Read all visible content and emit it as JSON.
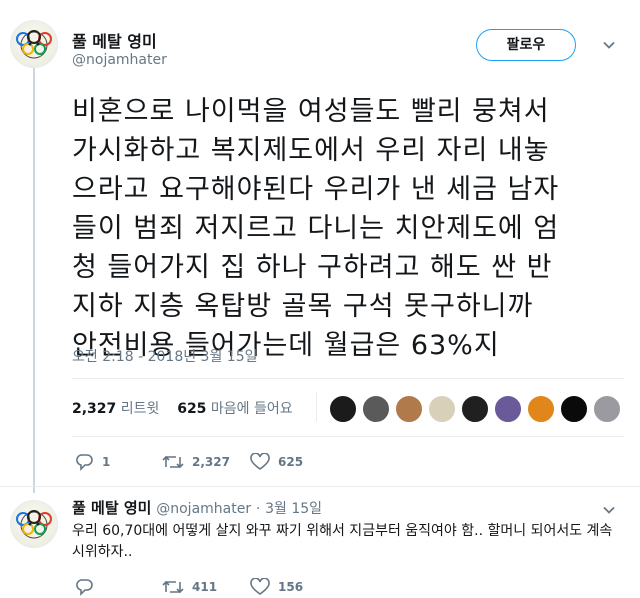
{
  "main_tweet": {
    "display_name": "풀 메탈 영미",
    "handle": "@nojamhater",
    "follow_label": "팔로우",
    "text_lines": [
      "비혼으로 나이먹을 여성들도 빨리 뭉쳐서",
      "가시화하고 복지제도에서 우리 자리 내놓",
      "으라고 요구해야된다 우리가 낸 세금 남자",
      "들이 범죄 저지르고 다니는 치안제도에 엄",
      "청 들어가지 집 하나 구하려고 해도 싼 반",
      "지하 지층 옥탑방 골목 구석 못구하니까",
      "안전비용 들어가는데 월급은 63%지"
    ],
    "timestamp": "오전 2:18 - 2018년 3월 15일",
    "retweet_count": "2,327",
    "retweet_label": "리트윗",
    "like_count": "625",
    "like_label": "마음에 들어요",
    "actions": {
      "reply": "1",
      "retweet": "2,327",
      "like": "625"
    }
  },
  "likers": [
    {
      "color": "#1b1b1b"
    },
    {
      "color": "#5a5a5a"
    },
    {
      "color": "#b07a4a"
    },
    {
      "color": "#d8d0b8"
    },
    {
      "color": "#202020"
    },
    {
      "color": "#6a5a9a"
    },
    {
      "color": "#e0861a"
    },
    {
      "color": "#0a0a0a"
    },
    {
      "color": "#9a9aa0"
    }
  ],
  "reply_tweet": {
    "display_name": "풀 메탈 영미",
    "handle": "@nojamhater",
    "separator": "·",
    "date": "3월 15일",
    "text": "우리 60,70대에 어떻게 살지 와꾸 짜기 위해서 지금부터 움직여야 함.. 할머니 되어서도 계속 시위하자..",
    "actions": {
      "reply": "",
      "retweet": "411",
      "like": "156"
    }
  },
  "colors": {
    "accent": "#1da1f2",
    "secondary": "#657786",
    "text": "#14171a",
    "divider": "#e6ecf0"
  },
  "icons": [
    "reply-icon",
    "retweet-icon",
    "heart-icon",
    "chevron-down-icon",
    "avatar"
  ]
}
